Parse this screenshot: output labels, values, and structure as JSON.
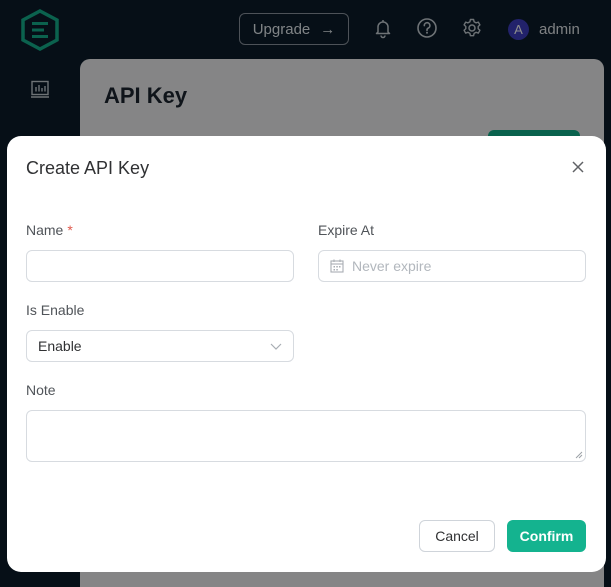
{
  "header": {
    "upgrade_label": "Upgrade",
    "upgrade_arrow": "→",
    "icons": [
      "bell-icon",
      "help-icon",
      "gear-icon"
    ],
    "user": {
      "avatar_letter": "A",
      "name": "admin"
    }
  },
  "sidebar": {
    "icons": [
      "dashboard-icon"
    ]
  },
  "page": {
    "title": "API Key"
  },
  "modal": {
    "title": "Create API Key",
    "fields": {
      "name": {
        "label": "Name",
        "required_mark": "*",
        "value": ""
      },
      "expire_at": {
        "label": "Expire At",
        "placeholder": "Never expire"
      },
      "is_enable": {
        "label": "Is Enable",
        "value": "Enable"
      },
      "note": {
        "label": "Note",
        "value": ""
      }
    },
    "buttons": {
      "cancel": "Cancel",
      "confirm": "Confirm"
    }
  },
  "colors": {
    "accent": "#14b38f",
    "background": "#0b1c2b",
    "avatar": "#3f3fc4",
    "required": "#e0584b"
  }
}
